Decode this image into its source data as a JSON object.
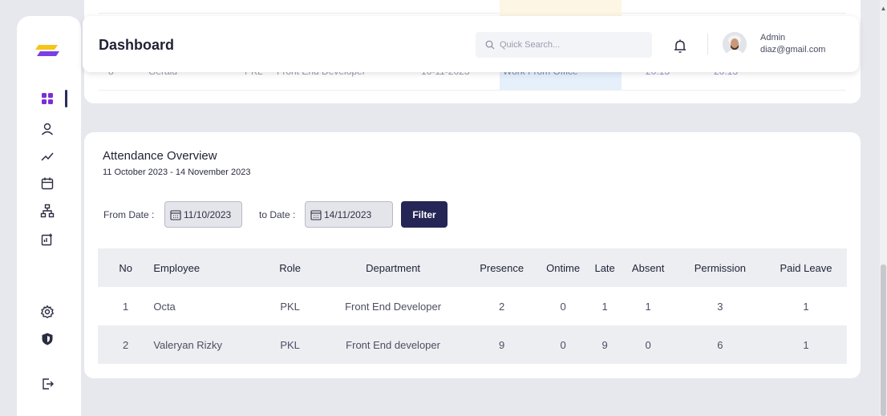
{
  "header": {
    "title": "Dashboard",
    "search_placeholder": "Quick Search...",
    "user_name": "Admin",
    "user_email": "diaz@gmail.com"
  },
  "sidebar": {
    "items": [
      {
        "icon": "dashboard-grid-icon",
        "active": true
      },
      {
        "icon": "user-icon"
      },
      {
        "icon": "chart-line-icon"
      },
      {
        "icon": "calendar-icon"
      },
      {
        "icon": "organization-icon"
      },
      {
        "icon": "report-add-icon"
      },
      {
        "icon": "gear-icon"
      },
      {
        "icon": "shield-icon"
      },
      {
        "icon": "logout-icon"
      }
    ]
  },
  "previous_table_row": {
    "no": "8",
    "name": "Gerald",
    "role": "PKL",
    "department": "Front End Developer",
    "date": "16-11-2023",
    "status": "Work From Office",
    "time_in": "20.13",
    "time_out": "20.13"
  },
  "attendance": {
    "title": "Attendance Overview",
    "range": "11 October 2023 - 14 November 2023",
    "from_label": "From Date :",
    "from_value": "11/10/2023",
    "to_label": "to Date :",
    "to_value": "14/11/2023",
    "filter_label": "Filter",
    "columns": [
      "No",
      "Employee",
      "Role",
      "Department",
      "Presence",
      "Ontime",
      "Late",
      "Absent",
      "Permission",
      "Paid Leave"
    ],
    "rows": [
      [
        "1",
        "Octa",
        "PKL",
        "Front End Developer",
        "2",
        "0",
        "1",
        "1",
        "3",
        "1"
      ],
      [
        "2",
        "Valeryan Rizky",
        "PKL",
        "Front End developer",
        "9",
        "0",
        "9",
        "0",
        "6",
        "1"
      ]
    ]
  },
  "colors": {
    "accent": "#252656",
    "logo_yellow": "#f5c518",
    "logo_purple": "#7b3fe4"
  }
}
